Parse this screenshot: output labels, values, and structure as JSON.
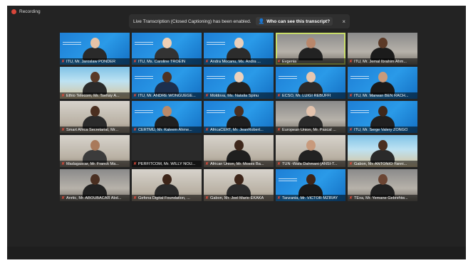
{
  "recording": {
    "label": "Recording"
  },
  "banner": {
    "text": "Live Transcription (Closed Captioning) has been enabled.",
    "link": "Who can see this transcript?",
    "close": "×"
  },
  "colors": {
    "muted_mic": "#e04a3a",
    "active_speaker_border": "#c9de6a",
    "tile_blue": "#1e7fd6"
  },
  "participants": [
    {
      "name": "ITU, Mr. Jaroslaw PONDER",
      "bg": "blue",
      "skin": "#e7c3a6",
      "shirt": "#2a2a2a"
    },
    {
      "name": "ITU, Ms. Caroline TROEIN",
      "bg": "blue",
      "skin": "#efcfb4",
      "shirt": "#333333"
    },
    {
      "name": "Andra Mocanu, Ms. Andra ...",
      "bg": "blue",
      "skin": "#ead0bb",
      "shirt": "#2c2c2c"
    },
    {
      "name": "Evgenia",
      "bg": "room",
      "skin": "#b9876b",
      "shirt": "#222222",
      "active": true
    },
    {
      "name": "ITU, Mr. Jemal Ibrahim Ahm...",
      "bg": "room",
      "skin": "#5c3a27",
      "shirt": "#1b1b1b"
    },
    {
      "name": "Ethio Telecom, Mr. Tsehay A...",
      "bg": "beach",
      "skin": "#5a3a28",
      "shirt": "#2a2a2a"
    },
    {
      "name": "ITU, Mr. ANDRE WONGUEGE...",
      "bg": "blue",
      "skin": "#4f3323",
      "shirt": "#1c2f4d"
    },
    {
      "name": "Moldova, Ms. Natalia Spinu",
      "bg": "blue",
      "skin": "#ecd2bd",
      "shirt": "#222222"
    },
    {
      "name": "ECSO, Mr. LUIGI REBUFFI",
      "bg": "blue",
      "skin": "#e6c7b0",
      "shirt": "#2a2a2a"
    },
    {
      "name": "ITU, Mr. Marwan BEN RACH...",
      "bg": "blue",
      "skin": "#c99b7c",
      "shirt": "#1a1a1a"
    },
    {
      "name": "Smart Africa Secretariat, Mr...",
      "bg": "office",
      "skin": "#4b2f20",
      "shirt": "#2b2b2b"
    },
    {
      "name": "CERTMU, Mr. Kaleem Ahme...",
      "bg": "blue",
      "skin": "#b98a6a",
      "shirt": "#202020"
    },
    {
      "name": "AfricaCERT, Mr. JeanRobert...",
      "bg": "blue",
      "skin": "#4a2f21",
      "shirt": "#1f1f1f"
    },
    {
      "name": "European Union, Mr. Pascal ...",
      "bg": "room",
      "skin": "#e3c3ad",
      "shirt": "#2a2a2a"
    },
    {
      "name": "ITU, Mr. Serge Valery ZONGO",
      "bg": "blue",
      "skin": "#3f281b",
      "shirt": "#202020"
    },
    {
      "name": "Madagascar, Mr. Franck Ma...",
      "bg": "office",
      "skin": "#a97a5b",
      "shirt": "#3b3b3b"
    },
    {
      "name": "PERFITCOM, Mr. WILLY NOU...",
      "bg": "dark",
      "skin": "",
      "shirt": ""
    },
    {
      "name": "African Union, Mr. Moses Ba...",
      "bg": "office",
      "skin": "#3e271b",
      "shirt": "#1f1f1f"
    },
    {
      "name": "TUN -Wafa Dahmani (ANSI-T...",
      "bg": "office",
      "skin": "#c89a7c",
      "shirt": "#222222"
    },
    {
      "name": "Gabon, Mr. ANTONIO Yanni...",
      "bg": "beach",
      "skin": "#4a2f21",
      "shirt": "#2a2a2a"
    },
    {
      "name": "Anrtic, Mr. ABOUBACAR Abd...",
      "bg": "room",
      "skin": "#4a2f21",
      "shirt": "#222222"
    },
    {
      "name": "Gefona Digital Foundation, ...",
      "bg": "office",
      "skin": "#3d2519",
      "shirt": "#2b2b2b"
    },
    {
      "name": "Gabon, Mr. Joel Mario EKAKA",
      "bg": "office",
      "skin": "#3d2519",
      "shirt": "#2c2c2c"
    },
    {
      "name": "Tanzania, Mr. VICTOR MZIRAY",
      "bg": "blue",
      "skin": "#3d2519",
      "shirt": "#1b1b1b"
    },
    {
      "name": "TExa, Mr. Yemane Gebrehiw...",
      "bg": "room",
      "skin": "#6b4533",
      "shirt": "#222222"
    }
  ]
}
